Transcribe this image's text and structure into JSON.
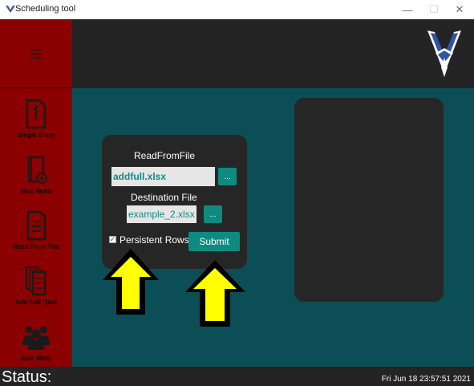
{
  "window": {
    "title": "Scheduling tool",
    "controls": {
      "minimize": "—",
      "maximize": "☐",
      "close": "✕"
    }
  },
  "sidebar": {
    "menu_icon": "hamburger-icon",
    "items": [
      {
        "label": "Single Entry",
        "icon": "document-number-icon"
      },
      {
        "label": "New Work",
        "icon": "book-add-icon"
      },
      {
        "label": "Read From File",
        "icon": "file-list-icon"
      },
      {
        "label": "Add Full Qual",
        "icon": "stacked-documents-icon"
      },
      {
        "label": "Add MMS",
        "icon": "people-group-icon"
      }
    ]
  },
  "header": {
    "logo": "air-force-wings-logo"
  },
  "form": {
    "read_label": "ReadFromFile",
    "read_value": "addfull.xlsx",
    "browse_label": "...",
    "dest_label": "Destination File",
    "dest_value": "example_2.xlsx",
    "dest_browse_label": "...",
    "persistent_rows_label": "Persistent Rows",
    "persistent_rows_checked": true,
    "submit_label": "Submit"
  },
  "annotations": {
    "arrow_color": "#ffff00",
    "arrow_icon": "up-arrow-icon"
  },
  "status": {
    "label": "Status:",
    "datetime": "Fri Jun 18 23:57:51 2021"
  },
  "colors": {
    "sidebar": "#8b0000",
    "header": "#242424",
    "main": "#0c4e55",
    "accent": "#0e8a80"
  }
}
